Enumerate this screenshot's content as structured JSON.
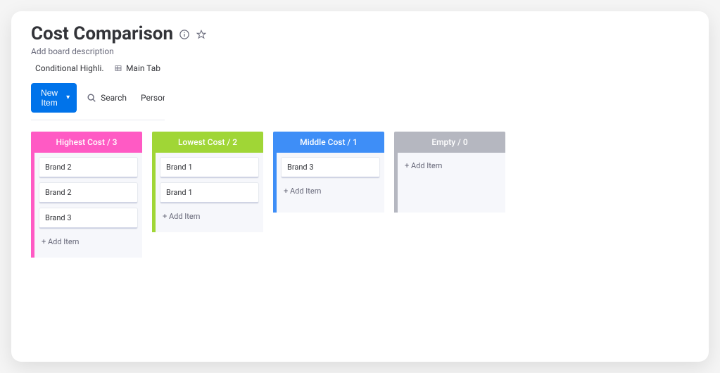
{
  "header": {
    "title": "Cost Comparison",
    "description": "Add board description"
  },
  "views": [
    {
      "label": "Conditional Highli…",
      "icon": "conditional-highlight-icon"
    },
    {
      "label": "Main Tab",
      "icon": "table-icon"
    }
  ],
  "toolbar": {
    "new_item_label": "New Item",
    "search_label": "Search",
    "person_label": "Person"
  },
  "columns": [
    {
      "key": "highest",
      "title": "Highest Cost",
      "count": 3,
      "color": "#FF5AC4",
      "items": [
        {
          "name": "Brand 2"
        },
        {
          "name": "Brand 2"
        },
        {
          "name": "Brand 3"
        }
      ],
      "add_label": "+ Add Item"
    },
    {
      "key": "lowest",
      "title": "Lowest Cost",
      "count": 2,
      "color": "#A0D636",
      "items": [
        {
          "name": "Brand 1"
        },
        {
          "name": "Brand 1"
        }
      ],
      "add_label": "+ Add Item"
    },
    {
      "key": "middle",
      "title": "Middle Cost",
      "count": 1,
      "color": "#3E8EF7",
      "items": [
        {
          "name": "Brand 3"
        }
      ],
      "add_label": "+ Add Item"
    },
    {
      "key": "empty",
      "title": "Empty",
      "count": 0,
      "color": "#B5B7C0",
      "items": [],
      "add_label": "+ Add Item"
    }
  ]
}
